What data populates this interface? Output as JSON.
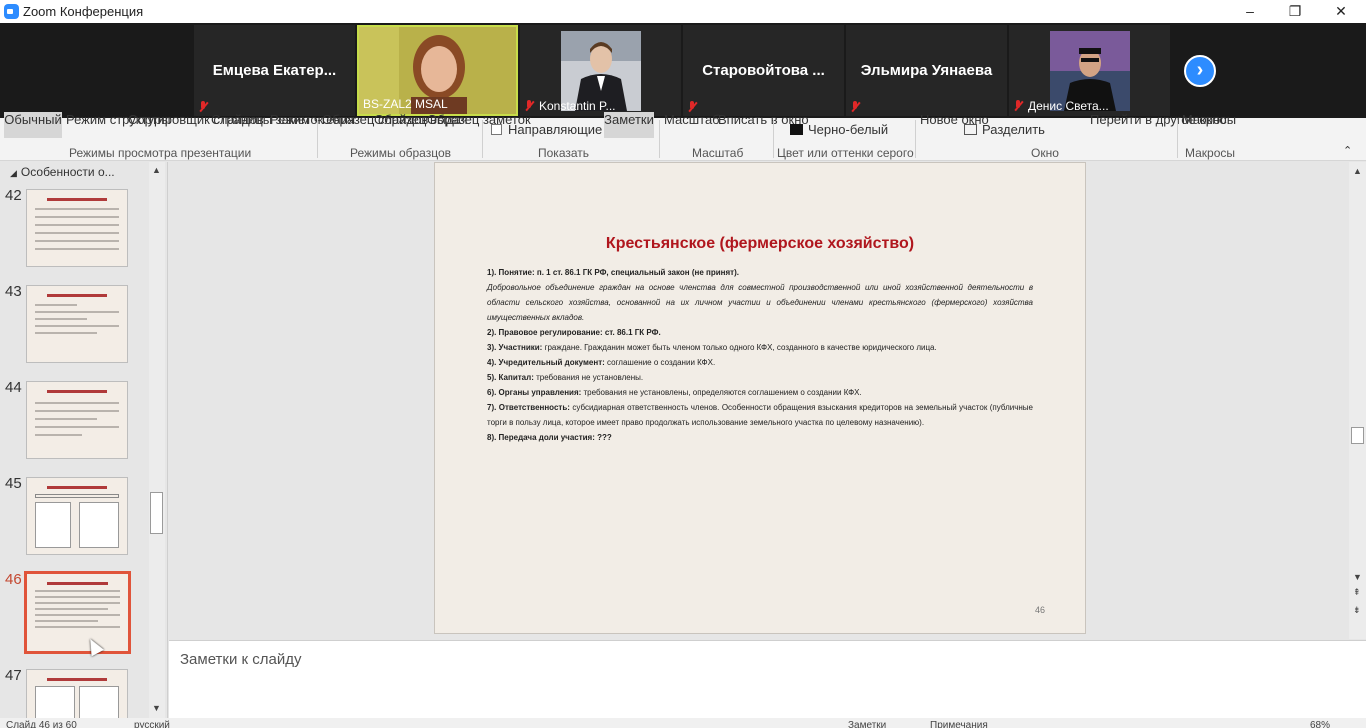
{
  "window": {
    "title": "Zoom Конференция",
    "minimize": "–",
    "restore": "❐",
    "close": "✕"
  },
  "participants": [
    {
      "name": "Емцева  Екатер...",
      "label": "",
      "video": false
    },
    {
      "name": "",
      "label": "BS-ZAL2 MSAL",
      "video": true,
      "active": true
    },
    {
      "name": "",
      "label": "Konstantin P...",
      "video": true
    },
    {
      "name": "Старовойтова ...",
      "label": "",
      "video": false
    },
    {
      "name": "Эльмира Уянаева",
      "label": "",
      "video": false
    },
    {
      "name": "",
      "label": "Денис Света...",
      "video": true
    }
  ],
  "next_label": "›",
  "ribbon": {
    "view_buttons": [
      "Обычный",
      "Режим структуры",
      "Сортировщик слайдов",
      "Страницы заметок",
      "Режим чтения"
    ],
    "view_group": "Режимы просмотра презентации",
    "master_buttons": [
      "Образец слайдов",
      "Образец выдач",
      "Образец заметок"
    ],
    "master_group": "Режимы образцов",
    "guides": "Направляющие",
    "notes_btn": "Заметки",
    "show_group": "Показать",
    "zoom_btn": "Масштаб",
    "fit_btn": "Вписать в окно",
    "zoom_group": "Масштаб",
    "bw": "Черно-белый",
    "color_group": "Цвет или оттенки серого",
    "new_window": "Новое окно",
    "split": "Разделить",
    "switch_window": "Перейти в другое окно",
    "window_group": "Окно",
    "macros_btn": "Макросы",
    "macros_group": "Макросы"
  },
  "thumbnails": {
    "section": "Особенности о...",
    "items": [
      {
        "num": "42"
      },
      {
        "num": "43"
      },
      {
        "num": "44"
      },
      {
        "num": "45"
      },
      {
        "num": "46",
        "current": true
      },
      {
        "num": "47"
      }
    ]
  },
  "slide": {
    "title": "Крестьянское (фермерское хозяйство)",
    "p1_label": "1). Понятие: п. 1 ст. 86.1 ГК РФ, специальный закон (не принят).",
    "p1_text": "Добровольное объединение граждан на основе членства для совместной производственной или иной хозяйственной деятельности в области сельского хозяйства, основанной на их личном участии и объединении членами крестьянского (фермерского) хозяйства имущественных вкладов.",
    "p2": "2). Правовое регулирование: ст. 86.1 ГК РФ.",
    "p3_label": "3). Участники:",
    "p3_text": " граждане. Гражданин может быть членом только одного КФХ, созданного в качестве юридического лица.",
    "p4_label": "4). Учредительный документ:",
    "p4_text": " соглашение о создании КФХ.",
    "p5_label": "5). Капитал:",
    "p5_text": " требования не установлены.",
    "p6_label": "6). Органы управления:",
    "p6_text": " требования не установлены, определяются соглашением о создании КФХ.",
    "p7_label": "7). Ответственность:",
    "p7_text": " субсидиарная ответственность членов. Особенности обращения взыскания кредиторов на земельный участок (публичные торги в пользу лица, которое имеет право продолжать использование земельного участка по целевому назначению).",
    "p8": "8). Передача доли участия: ???",
    "page_number": "46"
  },
  "notes": {
    "placeholder": "Заметки к слайду"
  },
  "statusbar": {
    "slide_info": "Слайд 46 из 60",
    "language": "русский",
    "notes": "Заметки",
    "comments": "Примечания",
    "zoom": "68%"
  },
  "colors": {
    "zoom_blue": "#2d8cff",
    "slide_title": "#b0161d",
    "current_thumb": "#e0543a",
    "active_speaker": "#c7dd4a"
  }
}
